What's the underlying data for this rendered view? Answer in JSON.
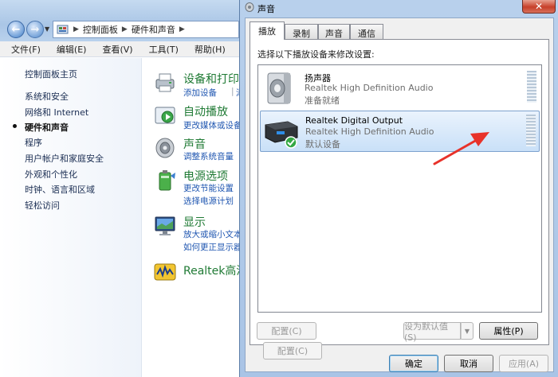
{
  "control_panel": {
    "address": [
      "控制面板",
      "硬件和声音"
    ],
    "menu": [
      "文件(F)",
      "编辑(E)",
      "查看(V)",
      "工具(T)",
      "帮助(H)"
    ],
    "sidebar": [
      {
        "label": "控制面板主页"
      },
      {
        "label": "系统和安全"
      },
      {
        "label": "网络和 Internet"
      },
      {
        "label": "硬件和声音",
        "active": true
      },
      {
        "label": "程序"
      },
      {
        "label": "用户帐户和家庭安全"
      },
      {
        "label": "外观和个性化"
      },
      {
        "label": "时钟、语言和区域"
      },
      {
        "label": "轻松访问"
      }
    ],
    "categories": [
      {
        "title": "设备和打印",
        "links": [
          "添加设备",
          "添"
        ],
        "icon": "printer-icon"
      },
      {
        "title": "自动播放",
        "links": [
          "更改媒体或设备"
        ],
        "icon": "autoplay-icon"
      },
      {
        "title": "声音",
        "links": [
          "调整系统音量"
        ],
        "icon": "speaker-icon"
      },
      {
        "title": "电源选项",
        "links": [
          "更改节能设置",
          "选择电源计划"
        ],
        "icon": "battery-icon"
      },
      {
        "title": "显示",
        "links": [
          "放大或缩小文本",
          "如何更正显示器"
        ],
        "icon": "monitor-icon"
      },
      {
        "title": "Realtek高清",
        "links": [],
        "icon": "realtek-icon"
      }
    ]
  },
  "dialog": {
    "title": "声音",
    "close": "✕",
    "tabs": [
      {
        "label": "播放",
        "active": true
      },
      {
        "label": "录制"
      },
      {
        "label": "声音"
      },
      {
        "label": "通信"
      }
    ],
    "instruction": "选择以下播放设备来修改设置:",
    "devices": [
      {
        "name": "扬声器",
        "driver": "Realtek High Definition Audio",
        "status": "准备就绪",
        "selected": false,
        "icon": "speaker-device-icon"
      },
      {
        "name": "Realtek Digital Output",
        "driver": "Realtek High Definition Audio",
        "status": "默认设备",
        "selected": true,
        "icon": "digital-output-icon"
      }
    ],
    "buttons": {
      "configure": "配置(C)",
      "set_default": "设为默认值(S)",
      "properties": "属性(P)",
      "ok": "确定",
      "cancel": "取消",
      "apply": "应用(A)"
    }
  },
  "colors": {
    "annotation": "#e8322a",
    "category_title": "#1f7a34",
    "link": "#1e55b0"
  }
}
